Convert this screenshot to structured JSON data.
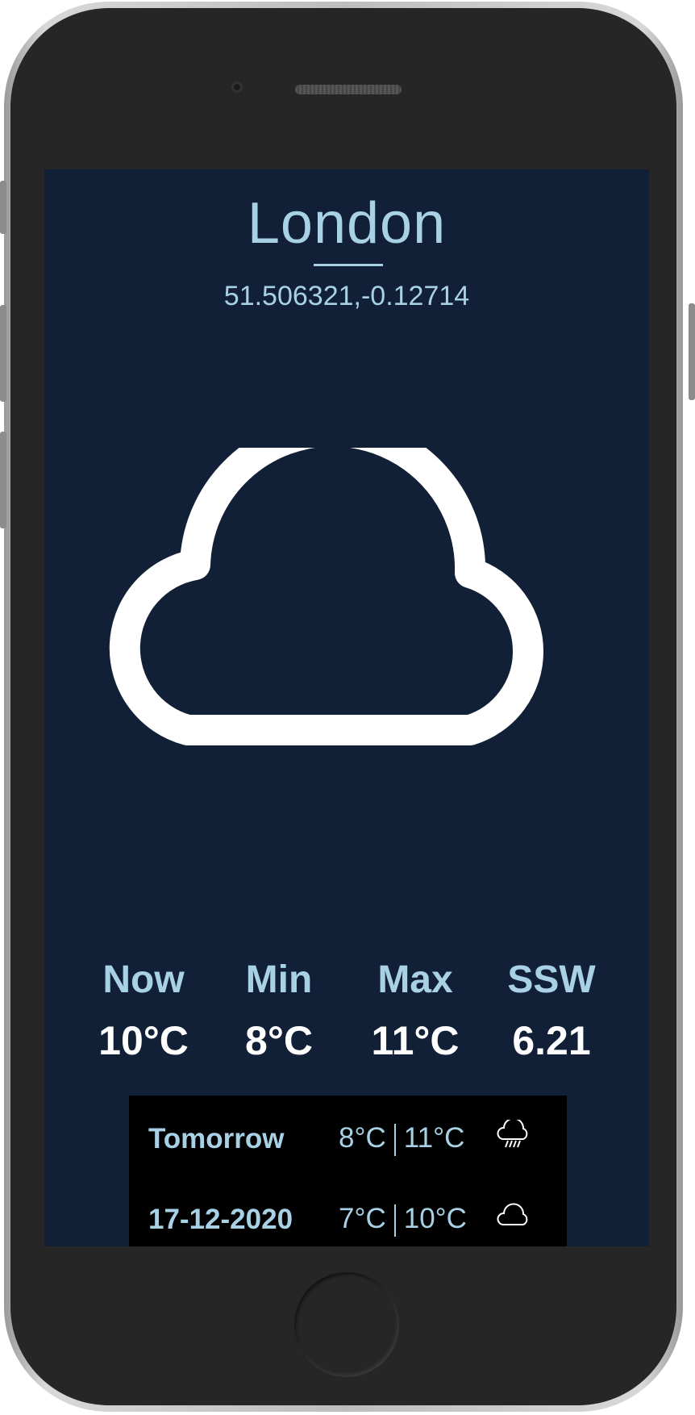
{
  "location": {
    "city": "London",
    "coordinates": "51.506321,-0.12714"
  },
  "current": {
    "icon": "cloud-icon",
    "stats": [
      {
        "label": "Now",
        "value": "10°C"
      },
      {
        "label": "Min",
        "value": "8°C"
      },
      {
        "label": "Max",
        "value": "11°C"
      },
      {
        "label": "SSW",
        "value": "6.21"
      }
    ]
  },
  "forecast": [
    {
      "day": "Tomorrow",
      "min": "8°C",
      "max": "11°C",
      "icon": "rain-cloud-icon"
    },
    {
      "day": "17-12-2020",
      "min": "7°C",
      "max": "10°C",
      "icon": "cloud-icon"
    }
  ],
  "colors": {
    "background": "#112036",
    "accent": "#a9d1e6",
    "forecast_panel": "#000000",
    "value_text": "#ffffff"
  }
}
